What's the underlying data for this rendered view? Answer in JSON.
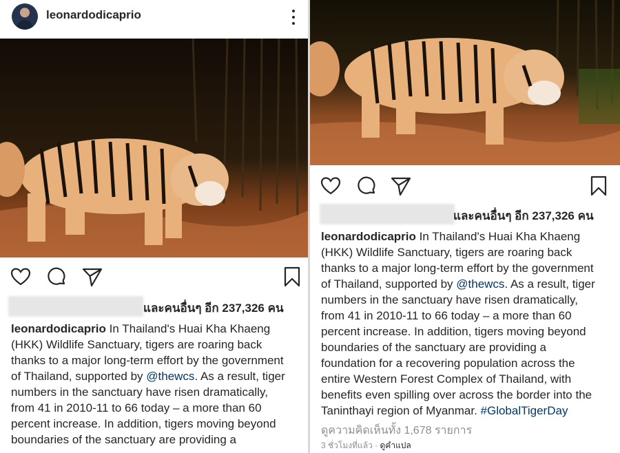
{
  "left_post": {
    "username": "leonardodicaprio",
    "likes_text": "และคนอื่นๆ อีก 237,326 คน",
    "caption_lines": [
      [
        {
          "t": "leonardodicaprio",
          "k": "user"
        },
        {
          "t": " In Thailand's Huai Kha Khaeng",
          "k": "text"
        }
      ],
      [
        {
          "t": "(HKK) Wildlife Sanctuary, tigers are roaring back",
          "k": "text"
        }
      ],
      [
        {
          "t": "thanks to a major long-term effort by the government",
          "k": "text"
        }
      ],
      [
        {
          "t": "of Thailand, supported by ",
          "k": "text"
        },
        {
          "t": "@thewcs",
          "k": "mention"
        },
        {
          "t": ". As a result, tiger",
          "k": "text"
        }
      ],
      [
        {
          "t": "numbers in the sanctuary have risen dramatically,",
          "k": "text"
        }
      ],
      [
        {
          "t": "from 41 in 2010-11 to 66 today – a more than 60",
          "k": "text"
        }
      ],
      [
        {
          "t": "percent increase. In addition, tigers moving beyond",
          "k": "text"
        }
      ],
      [
        {
          "t": "boundaries of the sanctuary are providing a",
          "k": "text"
        }
      ]
    ]
  },
  "right_post": {
    "likes_text": "และคนอื่นๆ อีก 237,326 คน",
    "caption_lines": [
      [
        {
          "t": "leonardodicaprio",
          "k": "user"
        },
        {
          "t": " In Thailand's Huai Kha Khaeng",
          "k": "text"
        }
      ],
      [
        {
          "t": "(HKK) Wildlife Sanctuary, tigers are roaring back",
          "k": "text"
        }
      ],
      [
        {
          "t": "thanks to a major long-term effort by the government",
          "k": "text"
        }
      ],
      [
        {
          "t": "of Thailand, supported by ",
          "k": "text"
        },
        {
          "t": "@thewcs",
          "k": "mention"
        },
        {
          "t": ". As a result, tiger",
          "k": "text"
        }
      ],
      [
        {
          "t": "numbers in the sanctuary have risen dramatically,",
          "k": "text"
        }
      ],
      [
        {
          "t": "from 41 in 2010-11 to 66 today – a more than 60",
          "k": "text"
        }
      ],
      [
        {
          "t": "percent increase. In addition, tigers moving beyond",
          "k": "text"
        }
      ],
      [
        {
          "t": "boundaries of the sanctuary are providing a",
          "k": "text"
        }
      ],
      [
        {
          "t": "foundation for a recovering population across the",
          "k": "text"
        }
      ],
      [
        {
          "t": "entire Western Forest Complex of Thailand, with",
          "k": "text"
        }
      ],
      [
        {
          "t": "benefits even spilling over across the border into the",
          "k": "text"
        }
      ],
      [
        {
          "t": "Taninthayi region of Myanmar. ",
          "k": "text"
        },
        {
          "t": "#GlobalTigerDay",
          "k": "hashtag"
        }
      ]
    ],
    "comments_link": "ดูความคิดเห็นทั้ง 1,678 รายการ",
    "time_ago": "3 ชั่วโมงที่แล้ว",
    "meta_separator": " · ",
    "translate_label": "ดูคำแปล"
  },
  "icons": {
    "like": "heart-icon",
    "comment": "comment-bubble-icon",
    "share": "paper-plane-icon",
    "save": "bookmark-icon",
    "more": "more-vertical-icon"
  },
  "colors": {
    "text": "#262626",
    "link": "#00376b",
    "secondary": "#8e8e8e"
  }
}
